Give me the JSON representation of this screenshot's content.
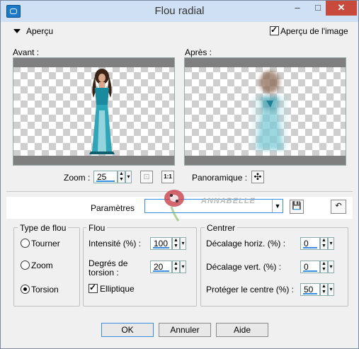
{
  "window": {
    "title": "Flou radial"
  },
  "titlebar": {
    "min": "–",
    "max": "□",
    "close": "✕"
  },
  "apercu": {
    "label": "Aperçu",
    "show_image_label": "Aperçu de l'image",
    "show_image_checked": true
  },
  "previews": {
    "before_label": "Avant :",
    "after_label": "Après :"
  },
  "zoom": {
    "label": "Zoom :",
    "value": "25"
  },
  "pan": {
    "label": "Panoramique :"
  },
  "params": {
    "label": "Paramètres",
    "value": ""
  },
  "watermark": {
    "text": "ANNABELLE"
  },
  "blur_type": {
    "title": "Type de flou",
    "options": [
      "Tourner",
      "Zoom",
      "Torsion"
    ],
    "selected": "Torsion"
  },
  "blur": {
    "title": "Flou",
    "intensity_label": "Intensité (%) :",
    "intensity_value": "100",
    "torsion_label_1": "Degrés de",
    "torsion_label_2": "torsion :",
    "torsion_value": "20",
    "elliptic_label": "Elliptique",
    "elliptic_checked": true
  },
  "center": {
    "title": "Centrer",
    "hoffset_label": "Décalage horiz. (%) :",
    "hoffset_value": "0",
    "voffset_label": "Décalage vert. (%) :",
    "voffset_value": "0",
    "protect_label": "Protéger le centre (%) :",
    "protect_value": "50"
  },
  "buttons": {
    "ok": "OK",
    "cancel": "Annuler",
    "help": "Aide"
  }
}
